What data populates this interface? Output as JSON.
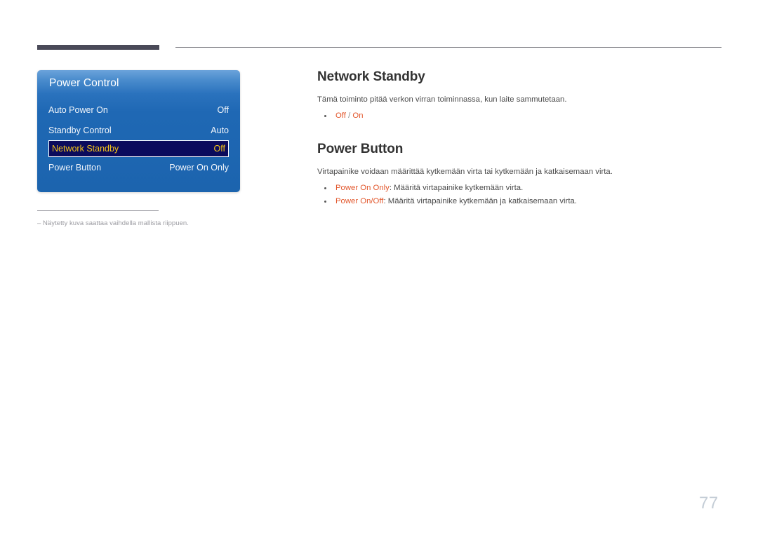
{
  "page": {
    "number": "77"
  },
  "osd": {
    "title": "Power Control",
    "rows": [
      {
        "label": "Auto Power On",
        "value": "Off",
        "selected": false
      },
      {
        "label": "Standby Control",
        "value": "Auto",
        "selected": false
      },
      {
        "label": "Network Standby",
        "value": "Off",
        "selected": true
      },
      {
        "label": "Power Button",
        "value": "Power On Only",
        "selected": false
      }
    ]
  },
  "footnote": {
    "marker": "‒",
    "text": "‒  Näytetty kuva saattaa vaihdella mallista riippuen."
  },
  "sections": [
    {
      "heading": "Network Standby",
      "body": "Tämä toiminto pitää verkon virran toiminnassa, kun laite sammutetaan.",
      "bullets": [
        {
          "term": "Off",
          "sep": " / ",
          "term2": "On",
          "desc": ""
        }
      ]
    },
    {
      "heading": "Power Button",
      "body": "Virtapainike voidaan määrittää kytkemään virta tai kytkemään ja katkaisemaan virta.",
      "bullets": [
        {
          "term": "Power On Only",
          "desc": ": Määritä virtapainike kytkemään virta."
        },
        {
          "term": "Power On/Off",
          "desc": ": Määritä virtapainike kytkemään ja katkaisemaan virta."
        }
      ]
    }
  ],
  "colors": {
    "accent_orange": "#e2562b",
    "osd_blue": "#1c64ae",
    "osd_selected_bg": "#0b0b5c",
    "osd_selected_text": "#f5c518",
    "rule_dark": "#4a4a58",
    "page_number": "#c4cdd6"
  }
}
